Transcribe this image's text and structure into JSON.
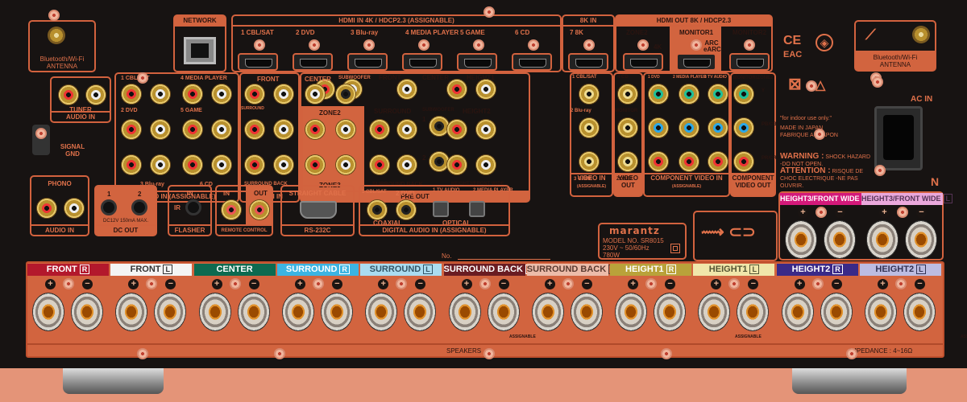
{
  "antenna_left": {
    "label1": "Bluetooth/Wi-Fi",
    "label2": "ANTENNA"
  },
  "antenna_right": {
    "label1": "Bluetooth/Wi-Fi",
    "label2": "ANTENNA"
  },
  "network": {
    "label": "NETWORK"
  },
  "hdmi_in": {
    "header": "HDMI IN  4K / HDCP2.3 (ASSIGNABLE)",
    "inputs": [
      "1 CBL/SAT",
      "2 DVD",
      "3 Blu-ray",
      "4 MEDIA PLAYER",
      "5 GAME",
      "6 CD"
    ]
  },
  "hdmi_8k": {
    "header": "8K  IN",
    "input": "7 8K"
  },
  "hdmi_out": {
    "header": "HDMI OUT  8K / HDCP2.3",
    "outputs": [
      "ZONE2",
      "MONITOR1",
      "MONITOR2"
    ],
    "zone2_note": "4K",
    "monitor1_note": "ARC eARC"
  },
  "tuner": {
    "label": "TUNER",
    "footer": "AUDIO IN",
    "r": "R",
    "l": "L"
  },
  "signal_gnd": "SIGNAL GND",
  "audio_in": {
    "labels": [
      "1 CBL/SAT",
      "4 MEDIA PLAYER",
      "2 DVD",
      "5 GAME",
      "3 Blu-ray",
      "6 CD"
    ],
    "footer": "AUDIO IN (ASSIGNABLE)"
  },
  "ch71_in": {
    "labels": [
      "FRONT",
      "SURROUND",
      "SURROUND BACK",
      "CENTER",
      "SUBWOOFER"
    ],
    "footer": "7.1CH IN"
  },
  "zone": {
    "zone2": "ZONE2",
    "zone3": "ZONE3"
  },
  "pre_out": {
    "labels": [
      "FRONT",
      "CENTER",
      "HEIGHT1",
      "SURROUND",
      "SUBWOOFER",
      "HEIGHT2",
      "SURROUND BACK",
      "HEIGHT3/FRONT WIDE"
    ],
    "sub_numbers": [
      "1",
      "2"
    ],
    "footer": "PRE OUT"
  },
  "video_in": {
    "labels": [
      "1 CBL/SAT",
      "2 Blu-ray",
      "3 GAME"
    ],
    "footer": "VIDEO IN",
    "note": "(ASSIGNABLE)"
  },
  "video_out": {
    "labels": [
      "4 CD",
      "MONITOR",
      "ZONE2"
    ],
    "footer": "VIDEO OUT"
  },
  "component_in": {
    "labels": [
      "1 DVD",
      "2 MEDIA PLAYER",
      "3 TV AUDIO"
    ],
    "footer": "COMPONENT VIDEO IN",
    "note": "(ASSIGNABLE)"
  },
  "component_out": {
    "label": "MONITOR/ZONE2",
    "footer": "COMPONENT VIDEO OUT",
    "channels": [
      "Y",
      "PB/CB",
      "PR/CR"
    ]
  },
  "compliance": {
    "indoor": "\"for indoor use only.\"",
    "made1": "MADE IN JAPAN",
    "made2": "FABRIQUE AU JAPON",
    "warning_title": "WARNING :",
    "warning_text": "SHOCK HAZARD -DO NOT OPEN.",
    "attention_title": "ATTENTION :",
    "attention_text": "RISQUE DE CHOC ELECTRIQUE -NE PAS OUVRIR."
  },
  "ac_in": "AC IN",
  "n_mark": "N",
  "phono": {
    "label": "PHONO",
    "footer": "AUDIO IN"
  },
  "dc_out": {
    "labels": [
      "1",
      "2"
    ],
    "spec": "DC12V 150mA MAX.",
    "footer": "DC OUT"
  },
  "flasher": {
    "in": "IN",
    "ir": "IR",
    "footer": "FLASHER"
  },
  "remote": {
    "in": "IN",
    "out": "OUT",
    "footer": "REMOTE CONTROL"
  },
  "rs232c": {
    "header": "STRAIGHT CABLE",
    "footer": "RS-232C"
  },
  "digital_in": {
    "labels": [
      "1 CBL/SAT",
      "2 DVD",
      "1 TV AUDIO",
      "2 MEDIA PLAYER"
    ],
    "coaxial": "COAXIAL",
    "optical": "OPTICAL",
    "footer": "DIGITAL AUDIO IN (ASSIGNABLE)"
  },
  "serial_no": "No.",
  "model_label": {
    "brand": "marantz",
    "model": "MODEL NO. SR8015",
    "power": "230V ~ 50/60Hz",
    "watts": "780W"
  },
  "speakers": {
    "channels": [
      {
        "name": "FRONT",
        "side": "R",
        "bg": "#b3182c",
        "fg": "#ffffff"
      },
      {
        "name": "FRONT",
        "side": "L",
        "bg": "#f4f4f4",
        "fg": "#333333"
      },
      {
        "name": "CENTER",
        "side": "",
        "bg": "#0d6a50",
        "fg": "#ffffff"
      },
      {
        "name": "SURROUND",
        "side": "R",
        "bg": "#3cb4e2",
        "fg": "#ffffff"
      },
      {
        "name": "SURROUND",
        "side": "L",
        "bg": "#aadcf0",
        "fg": "#335566"
      },
      {
        "name": "SURROUND BACK",
        "side": "R",
        "bg": "#6a1c22",
        "fg": "#ffffff"
      },
      {
        "name": "SURROUND BACK",
        "side": "L",
        "bg": "#ecbcaa",
        "fg": "#5a3a30"
      },
      {
        "name": "HEIGHT1",
        "side": "R",
        "bg": "#b9a23a",
        "fg": "#ffffff"
      },
      {
        "name": "HEIGHT1",
        "side": "L",
        "bg": "#f0e6aa",
        "fg": "#555533"
      },
      {
        "name": "HEIGHT2",
        "side": "R",
        "bg": "#3a2a88",
        "fg": "#ffffff"
      },
      {
        "name": "HEIGHT2",
        "side": "L",
        "bg": "#bcbce2",
        "fg": "#333355"
      }
    ],
    "height3": [
      {
        "name": "HEIGHT3/FRONT WIDE",
        "side": "R",
        "bg": "#d4197a",
        "fg": "#ffffff"
      },
      {
        "name": "HEIGHT3/FRONT WIDE",
        "side": "L",
        "bg": "#eaa8dc",
        "fg": "#553355"
      }
    ],
    "assignable": "ASSIGNABLE",
    "footer": "SPEAKERS",
    "impedance": "IMPEDANCE : 4~16Ω",
    "plus": "+",
    "minus": "−"
  },
  "colors": {
    "accent": "#d2643f",
    "chassis": "#171312",
    "background": "#e49478"
  }
}
